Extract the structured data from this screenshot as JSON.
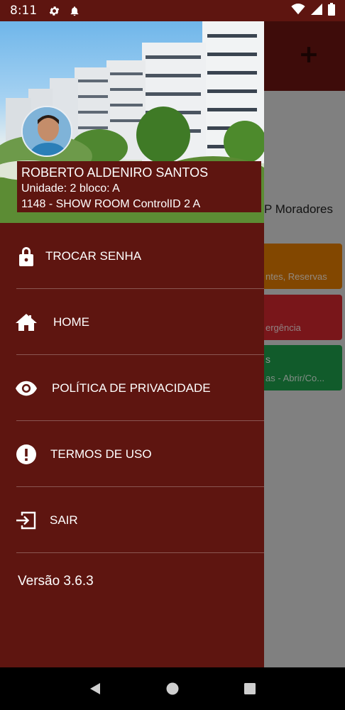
{
  "status_bar": {
    "time": "8:11",
    "icons": [
      "gear-icon",
      "bell-icon",
      "wifi-icon",
      "signal-icon",
      "battery-icon"
    ]
  },
  "background_app": {
    "title_fragment": "P Moradores",
    "cards": [
      {
        "color": "#e07a00",
        "sub": "ntes, Reservas",
        "main": ""
      },
      {
        "color": "#d0262d",
        "sub": "ergência",
        "main": ""
      },
      {
        "color": "#1e9e4a",
        "sub": "as - Abrir/Co...",
        "main": "s"
      }
    ]
  },
  "drawer": {
    "user": {
      "name": "ROBERTO ALDENIRO SANTOS",
      "unit": "Unidade: 2 bloco: A",
      "condo": "1148 - SHOW ROOM ControlID 2 A"
    },
    "menu": [
      {
        "id": "change-password",
        "icon": "lock-icon",
        "label": "TROCAR SENHA"
      },
      {
        "id": "home",
        "icon": "home-icon",
        "label": "HOME"
      },
      {
        "id": "privacy-policy",
        "icon": "eye-icon",
        "label": "POLÍTICA DE PRIVACIDADE"
      },
      {
        "id": "terms",
        "icon": "alert-circle-icon",
        "label": "TERMOS DE USO"
      },
      {
        "id": "logout",
        "icon": "exit-icon",
        "label": "SAIR"
      }
    ],
    "version": "Versão 3.6.3"
  },
  "colors": {
    "drawer_bg": "#5e1510",
    "appbar_bg": "#6b1612",
    "text": "#ffffff"
  }
}
